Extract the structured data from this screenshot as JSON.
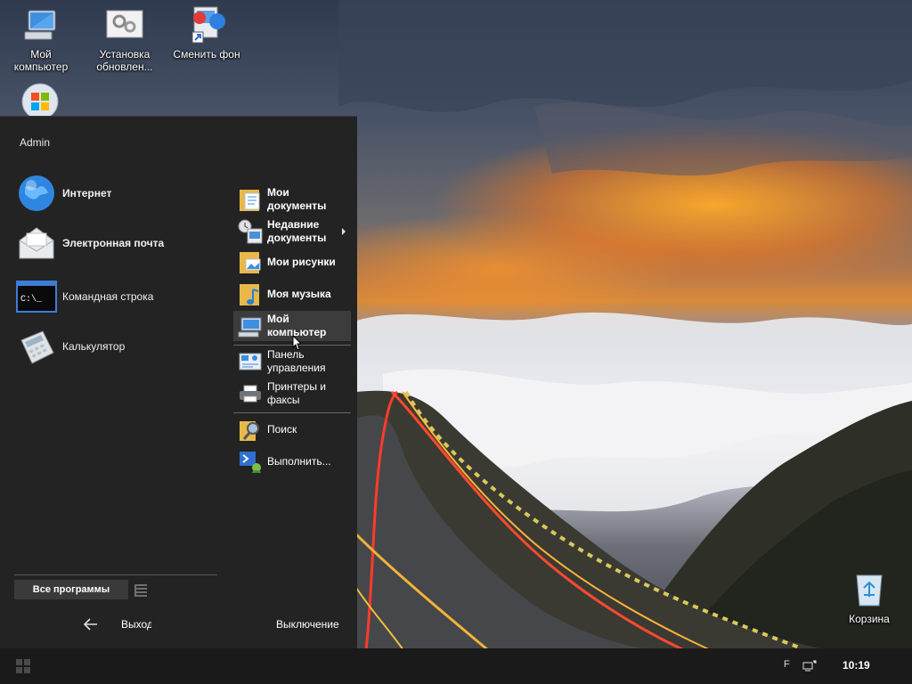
{
  "desktop": {
    "icons": [
      {
        "id": "computer",
        "label": "Мой\nкомпьютер"
      },
      {
        "id": "updates",
        "label": "Установка\nобновлен..."
      },
      {
        "id": "wallpaper",
        "label": "Сменить фон"
      },
      {
        "id": "recycle",
        "label": "Корзина"
      }
    ]
  },
  "start_menu": {
    "user": "Admin",
    "pinned": [
      {
        "label": "Интернет",
        "icon": "globe-icon"
      },
      {
        "label": "Электронная почта",
        "icon": "mail-icon"
      },
      {
        "label": "Командная строка",
        "icon": "cmd-icon"
      },
      {
        "label": "Калькулятор",
        "icon": "calculator-icon"
      }
    ],
    "right": [
      {
        "label": "Мои\nдокументы",
        "icon": "documents-icon"
      },
      {
        "label": "Недавние\nдокументы",
        "icon": "recent-documents-icon"
      },
      {
        "label": "Мои рисунки",
        "icon": "pictures-icon"
      },
      {
        "label": "Моя музыка",
        "icon": "music-icon"
      },
      {
        "label": "Мой\nкомпьютер",
        "icon": "computer-icon"
      },
      {
        "label": "Панель\nуправления",
        "icon": "control-panel-icon"
      },
      {
        "label": "Принтеры и\nфаксы",
        "icon": "printer-icon"
      },
      {
        "label": "Поиск",
        "icon": "search-icon"
      },
      {
        "label": "Выполнить...",
        "icon": "run-icon"
      }
    ],
    "all_programs": "Все программы",
    "logout": "Выход",
    "shutdown": "Выключение"
  },
  "taskbar": {
    "ime": "F",
    "clock": "10:19"
  }
}
